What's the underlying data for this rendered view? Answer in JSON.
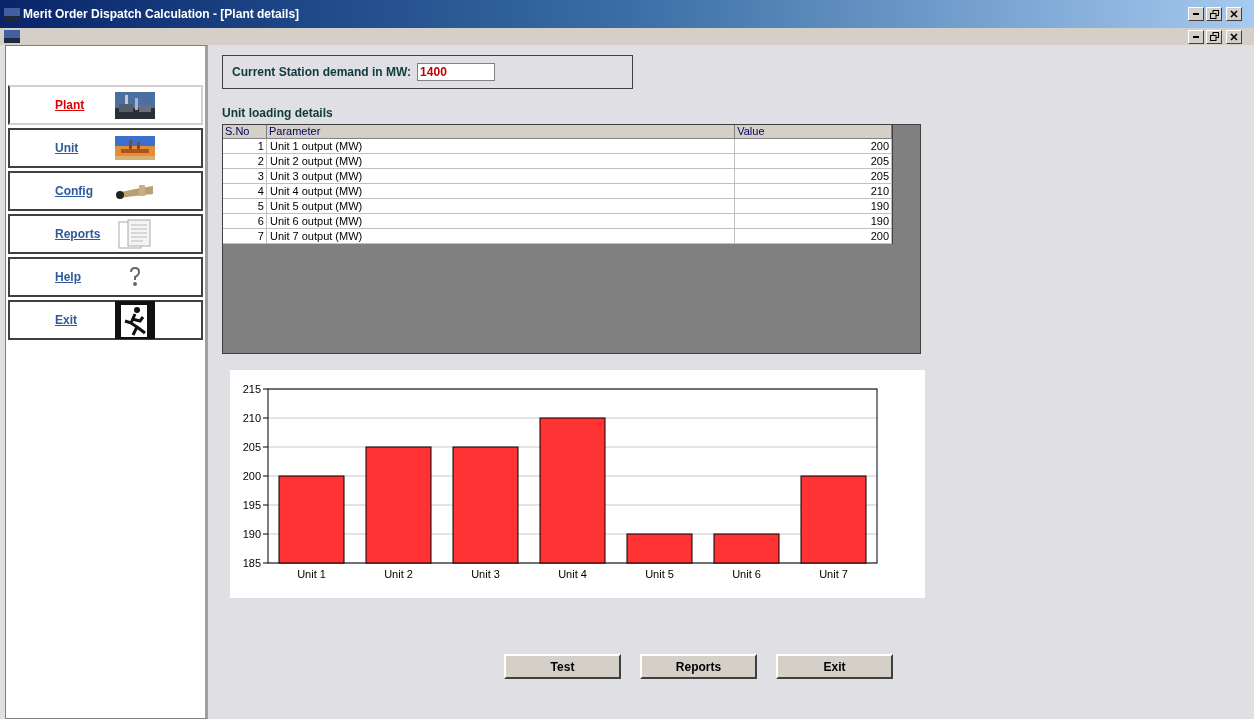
{
  "window": {
    "title": "Merit Order Dispatch Calculation - [Plant details]"
  },
  "sidebar": {
    "items": [
      {
        "label": "Plant",
        "kind": "plant",
        "selected": true
      },
      {
        "label": "Unit",
        "kind": "unit",
        "selected": false
      },
      {
        "label": "Config",
        "kind": "config",
        "selected": false
      },
      {
        "label": "Reports",
        "kind": "reports",
        "selected": false
      },
      {
        "label": "Help",
        "kind": "help",
        "selected": false
      },
      {
        "label": "Exit",
        "kind": "exit",
        "selected": false
      }
    ]
  },
  "demand": {
    "label": "Current Station demand in MW:",
    "value": "1400"
  },
  "table": {
    "title": "Unit loading details",
    "columns": [
      "S.No",
      "Parameter",
      "Value"
    ],
    "rows": [
      [
        "1",
        "Unit 1 output (MW)",
        "200"
      ],
      [
        "2",
        "Unit 2 output (MW)",
        "205"
      ],
      [
        "3",
        "Unit 3 output (MW)",
        "205"
      ],
      [
        "4",
        "Unit 4 output (MW)",
        "210"
      ],
      [
        "5",
        "Unit 5 output (MW)",
        "190"
      ],
      [
        "6",
        "Unit 6 output (MW)",
        "190"
      ],
      [
        "7",
        "Unit 7 output (MW)",
        "200"
      ]
    ]
  },
  "chart_data": {
    "type": "bar",
    "categories": [
      "Unit 1",
      "Unit 2",
      "Unit 3",
      "Unit 4",
      "Unit 5",
      "Unit 6",
      "Unit 7"
    ],
    "series": [
      {
        "color": "#ff3333",
        "values": [
          200,
          205,
          205,
          210,
          190,
          190,
          200
        ]
      }
    ],
    "grid": true,
    "ylim": [
      185,
      215
    ],
    "yticks": [
      185,
      190,
      195,
      200,
      205,
      210,
      215
    ]
  },
  "buttons": [
    "Test",
    "Reports",
    "Exit"
  ]
}
